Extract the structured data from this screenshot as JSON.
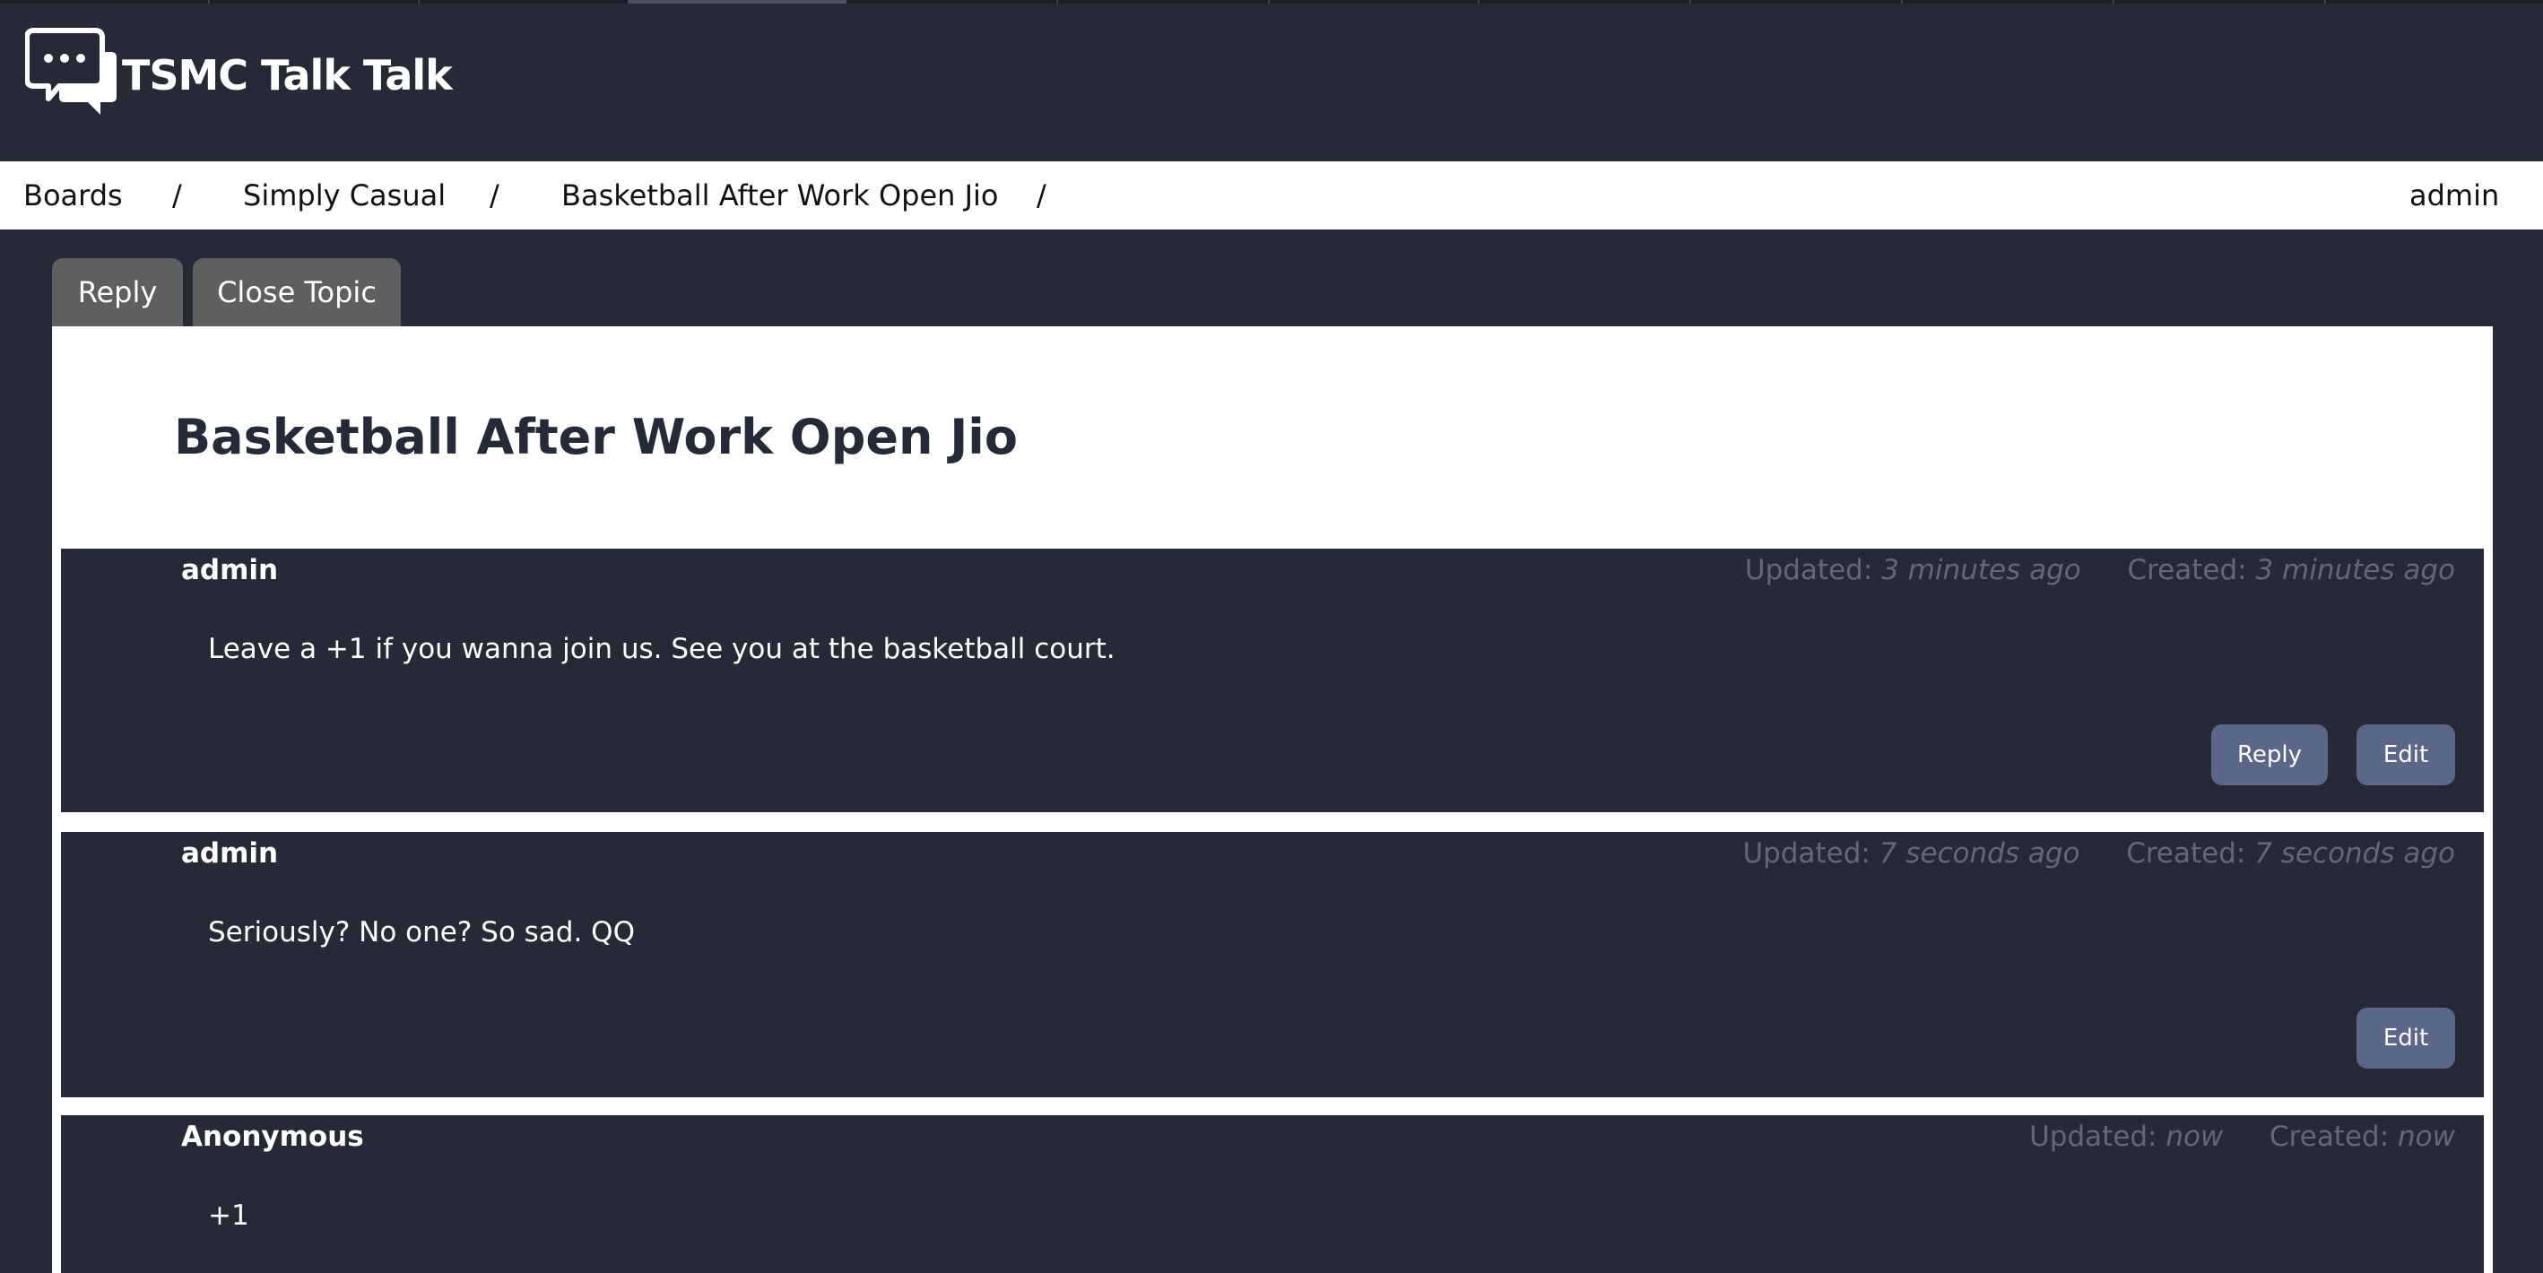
{
  "app": {
    "brand": "TSMC Talk Talk",
    "logo_icon": "chat-bubbles-icon"
  },
  "breadcrumb": {
    "items": [
      "Boards",
      "Simply Casual",
      "Basketball After Work Open Jio"
    ],
    "separator": "/",
    "user": "admin"
  },
  "topic_actions": {
    "reply": "Reply",
    "close": "Close Topic"
  },
  "topic": {
    "title": "Basketball After Work Open Jio"
  },
  "meta_labels": {
    "updated": "Updated:",
    "created": "Created:"
  },
  "posts": [
    {
      "author": "admin",
      "updated": "3 minutes ago",
      "created": "3 minutes ago",
      "body": "Leave a +1 if you wanna join us. See you at the basketball court.",
      "reply_label": "Reply",
      "edit_label": "Edit"
    },
    {
      "author": "admin",
      "updated": "7 seconds ago",
      "created": "7 seconds ago",
      "body": "Seriously? No one? So sad. QQ",
      "edit_label": "Edit"
    },
    {
      "author": "Anonymous",
      "updated": "now",
      "created": "now",
      "body": "+1"
    }
  ],
  "colors": {
    "page_bg": "#252a36",
    "post_bg": "#252a36",
    "post_button": "#5b6789",
    "topic_button": "#5e5f61",
    "meta_text": "#626877",
    "title_text": "#242a37"
  }
}
